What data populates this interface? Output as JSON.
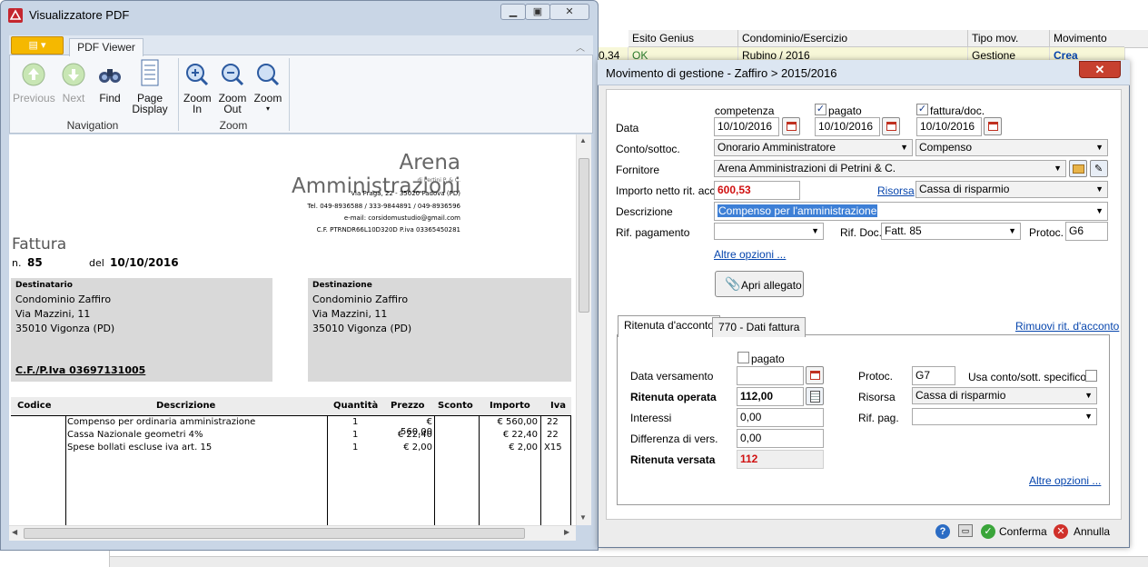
{
  "background_grid": {
    "headers": [
      "Esito Genius",
      "Condominio/Esercizio",
      "Tipo mov.",
      "Movimento"
    ],
    "row": {
      "amount": "0,34",
      "esito": "OK",
      "condominio": "Rubino / 2016",
      "tipo": "Gestione",
      "movimento": "Crea"
    }
  },
  "pdf_viewer": {
    "window_title": "Visualizzatore PDF",
    "tab": "PDF Viewer",
    "buttons": {
      "previous": "Previous",
      "next": "Next",
      "find": "Find",
      "page_display": "Page Display",
      "zoom_in": "Zoom In",
      "zoom_out": "Zoom Out",
      "zoom": "Zoom"
    },
    "groups": {
      "navigation": "Navigation",
      "zoom": "Zoom"
    },
    "document": {
      "company": "Arena Amministrazioni",
      "company_sub": "di Pertini P. & C.",
      "address": "Via Praga, 22 - 35020  Padova  (PD)",
      "phones": "Tel. 049-8936588 / 333-9844891 / 049-8936596",
      "email": "e-mail: corsidomustudio@gmail.com",
      "tax": "C.F. PTRNDR66L10D320D   P.iva 03365450281",
      "doc_type": "Fattura",
      "num_label": "n.",
      "num": "85",
      "date_label": "del",
      "date": "10/10/2016",
      "dest1_title": "Destinatario",
      "dest1_lines": [
        "Condominio Zaffiro",
        "Via Mazzini, 11",
        "35010  Vigonza  (PD)"
      ],
      "dest1_cf": "C.F./P.Iva 03697131005",
      "dest2_title": "Destinazione",
      "dest2_lines": [
        "Condominio Zaffiro",
        "Via Mazzini, 11",
        "35010  Vigonza  (PD)"
      ],
      "table_headers": [
        "Codice",
        "Descrizione",
        "Quantità",
        "Prezzo",
        "Sconto",
        "Importo",
        "Iva"
      ],
      "rows": [
        {
          "desc": "Compenso per ordinaria amministrazione",
          "qty": "1",
          "price": "€ 560,00",
          "amount": "€ 560,00",
          "iva": "22"
        },
        {
          "desc": "Cassa Nazionale geometri 4%",
          "qty": "1",
          "price": "€ 22,40",
          "amount": "€ 22,40",
          "iva": "22"
        },
        {
          "desc": "Spese bollati escluse iva art. 15",
          "qty": "1",
          "price": "€ 2,00",
          "amount": "€ 2,00",
          "iva": "X15"
        }
      ]
    }
  },
  "dialog": {
    "title": "Movimento di gestione - Zaffiro > 2015/2016",
    "competenza_label": "competenza",
    "pagato_label": "pagato",
    "fattura_label": "fattura/doc.",
    "data_label": "Data",
    "date_competenza": "10/10/2016",
    "date_pagato": "10/10/2016",
    "date_fattura": "10/10/2016",
    "conto_label": "Conto/sottoc.",
    "conto_value": "Onorario Amministratore",
    "sottoconto_value": "Compenso",
    "fornitore_label": "Fornitore",
    "fornitore_value": "Arena Amministrazioni di Petrini & C.",
    "importo_label": "Importo netto rit. acc.",
    "importo_value": "600,53",
    "risorsa_link": "Risorsa",
    "risorsa_value": "Cassa di risparmio",
    "descrizione_label": "Descrizione",
    "descrizione_value": "Compenso per l'amministrazione",
    "rif_pag_label": "Rif. pagamento",
    "rif_doc_label": "Rif. Doc.",
    "rif_doc_value": "Fatt. 85",
    "protoc_label": "Protoc.",
    "protoc_value": "G6",
    "altre_opzioni": "Altre opzioni ...",
    "apri_allegato": "Apri allegato",
    "tabs": [
      "Ritenuta d'acconto",
      "770 - Dati fattura"
    ],
    "rimuovi": "Rimuovi rit. d'acconto",
    "tab_content": {
      "pagato": "pagato",
      "data_versamento": "Data versamento",
      "protoc_label": "Protoc.",
      "protoc_value": "G7",
      "usa_conto": "Usa conto/sott. specifico",
      "ritenuta_operata_label": "Ritenuta operata",
      "ritenuta_operata_value": "112,00",
      "risorsa_label": "Risorsa",
      "risorsa_value": "Cassa di risparmio",
      "interessi_label": "Interessi",
      "interessi_value": "0,00",
      "rif_pag_label": "Rif. pag.",
      "differenza_label": "Differenza di vers.",
      "differenza_value": "0,00",
      "ritenuta_versata_label": "Ritenuta versata",
      "ritenuta_versata_value": "112",
      "altre_opzioni": "Altre opzioni ..."
    },
    "footer": {
      "confirm": "Conferma",
      "cancel": "Annulla"
    }
  },
  "colors": {
    "accent_red": "#d01010",
    "link": "#0645ad",
    "ribbon_orange": "#f5b800"
  }
}
